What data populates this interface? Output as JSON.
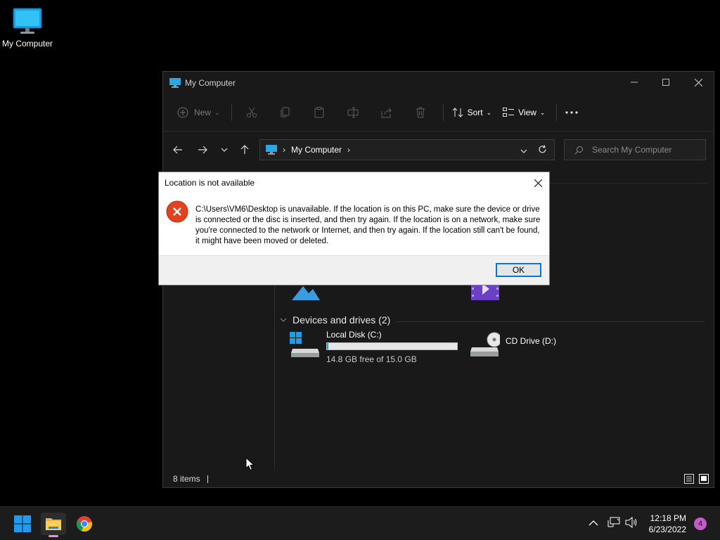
{
  "desktop": {
    "icon_label": "My Computer"
  },
  "window": {
    "title": "My Computer",
    "toolbar": {
      "new_label": "New",
      "sort_label": "Sort",
      "view_label": "View"
    },
    "address": {
      "crumb": "My Computer"
    },
    "search": {
      "placeholder": "Search My Computer"
    },
    "sections": {
      "folders_partial": [
        {
          "label": "Pictures"
        },
        {
          "label": "Videos"
        }
      ],
      "devices_header": "Devices and drives (2)",
      "drives": [
        {
          "name": "Local Disk (C:)",
          "free_text": "14.8 GB free of 15.0 GB",
          "used_fraction": 0.013
        },
        {
          "name": "CD Drive (D:)"
        }
      ]
    },
    "status": {
      "items": "8 items"
    }
  },
  "dialog": {
    "title": "Location is not available",
    "message": "C:\\Users\\VM6\\Desktop is unavailable. If the location is on this PC, make sure the device or drive is connected or the disc is inserted, and then try again. If the location is on a network, make sure you're connected to the network or Internet, and then try again. If the location still can't be found, it might have been moved or deleted.",
    "ok_label": "OK"
  },
  "taskbar": {
    "time": "12:18 PM",
    "date": "6/23/2022",
    "notification_count": "4"
  },
  "colors": {
    "accent": "#0078d7",
    "error": "#e0431e",
    "taskbar": "#1c1c1c"
  }
}
